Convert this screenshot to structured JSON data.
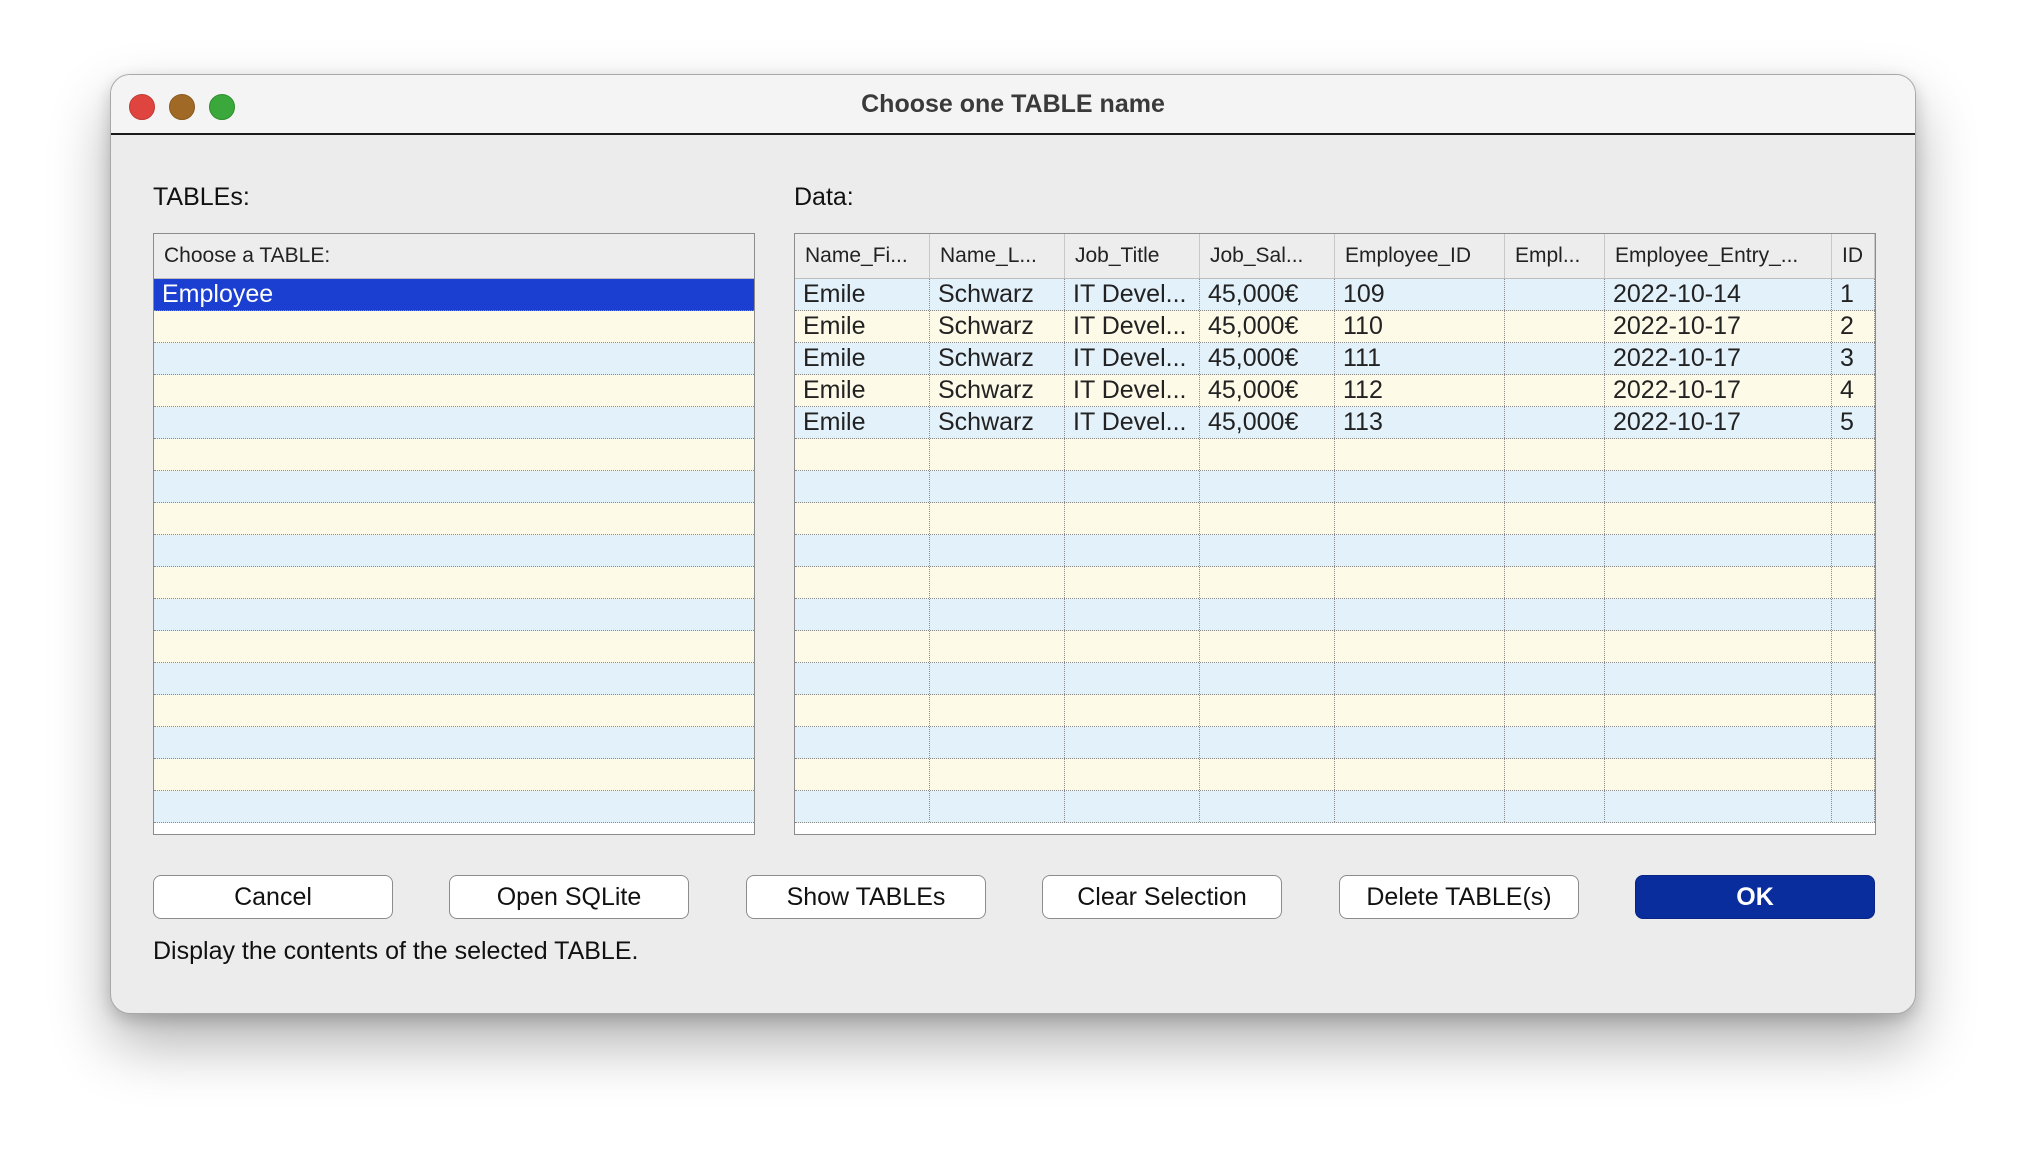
{
  "window": {
    "title": "Choose one TABLE name"
  },
  "tables_panel": {
    "label": "TABLEs:",
    "header": "Choose a TABLE:",
    "items": [
      "Employee"
    ],
    "selected_index": 0
  },
  "data_panel": {
    "label": "Data:",
    "columns": [
      "Name_Fi...",
      "Name_L...",
      "Job_Title",
      "Job_Sal...",
      "Employee_ID",
      "Empl...",
      "Employee_Entry_...",
      "ID"
    ],
    "rows": [
      [
        "Emile",
        "Schwarz",
        "IT Devel...",
        "45,000€",
        "109",
        "",
        "2022-10-14",
        "1"
      ],
      [
        "Emile",
        "Schwarz",
        "IT Devel...",
        "45,000€",
        "110",
        "",
        "2022-10-17",
        "2"
      ],
      [
        "Emile",
        "Schwarz",
        "IT Devel...",
        "45,000€",
        "111",
        "",
        "2022-10-17",
        "3"
      ],
      [
        "Emile",
        "Schwarz",
        "IT Devel...",
        "45,000€",
        "112",
        "",
        "2022-10-17",
        "4"
      ],
      [
        "Emile",
        "Schwarz",
        "IT Devel...",
        "45,000€",
        "113",
        "",
        "2022-10-17",
        "5"
      ]
    ]
  },
  "buttons": {
    "cancel": "Cancel",
    "open_sqlite": "Open SQLite",
    "show_tables": "Show TABLEs",
    "clear_selection": "Clear Selection",
    "delete_tables": "Delete TABLE(s)",
    "ok": "OK"
  },
  "status_text": "Display the contents of the selected TABLE.",
  "colors": {
    "selection": "#1b3fd0",
    "row_blue": "#e3f1fa",
    "row_cream": "#fefae8",
    "default_button": "#0a2d9e",
    "close": "#e0443e",
    "minimize": "#a06a26",
    "zoom": "#3aa83a"
  }
}
